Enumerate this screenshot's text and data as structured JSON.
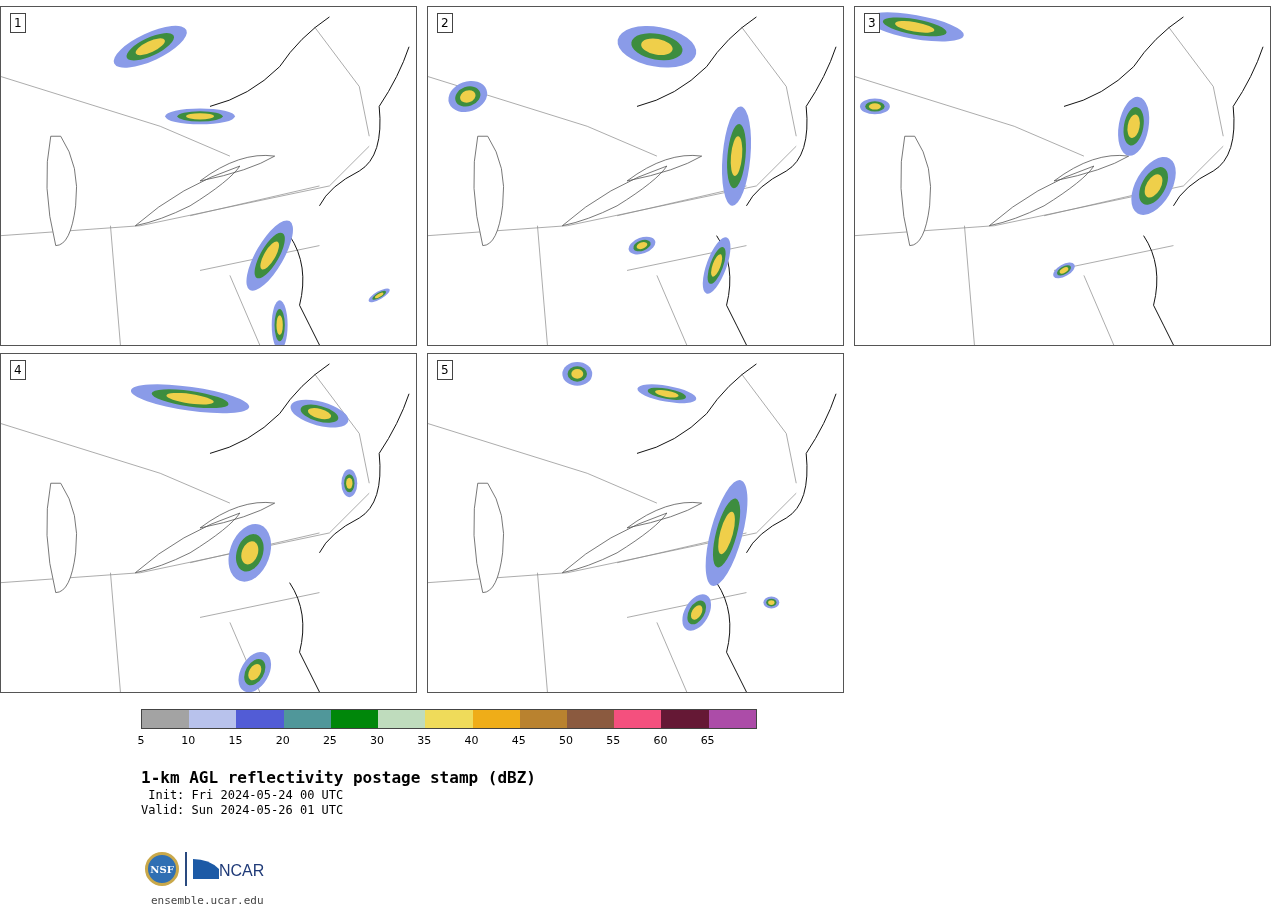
{
  "panels": [
    {
      "label": "1"
    },
    {
      "label": "2"
    },
    {
      "label": "3"
    },
    {
      "label": "4"
    },
    {
      "label": "5"
    }
  ],
  "colorbar": {
    "segments": [
      {
        "color": "#a3a3a3"
      },
      {
        "color": "#b8c2ec"
      },
      {
        "color": "#525cd6"
      },
      {
        "color": "#50979a"
      },
      {
        "color": "#00870a"
      },
      {
        "color": "#bfdcbd"
      },
      {
        "color": "#efdb5a"
      },
      {
        "color": "#efad18"
      },
      {
        "color": "#b9822f"
      },
      {
        "color": "#8b5a3f"
      },
      {
        "color": "#f4507e"
      },
      {
        "color": "#651835"
      },
      {
        "color": "#ac4ca8"
      }
    ],
    "ticks": [
      "5",
      "10",
      "15",
      "20",
      "25",
      "30",
      "35",
      "40",
      "45",
      "50",
      "55",
      "60",
      "65"
    ]
  },
  "title": "1-km AGL reflectivity postage stamp (dBZ)",
  "init": " Init: Fri 2024-05-24 00 UTC",
  "valid": "Valid: Sun 2024-05-26 01 UTC",
  "logo": {
    "seal_text": "NSF",
    "wordmark": "NCAR"
  },
  "footer_link": "ensemble.ucar.edu"
}
